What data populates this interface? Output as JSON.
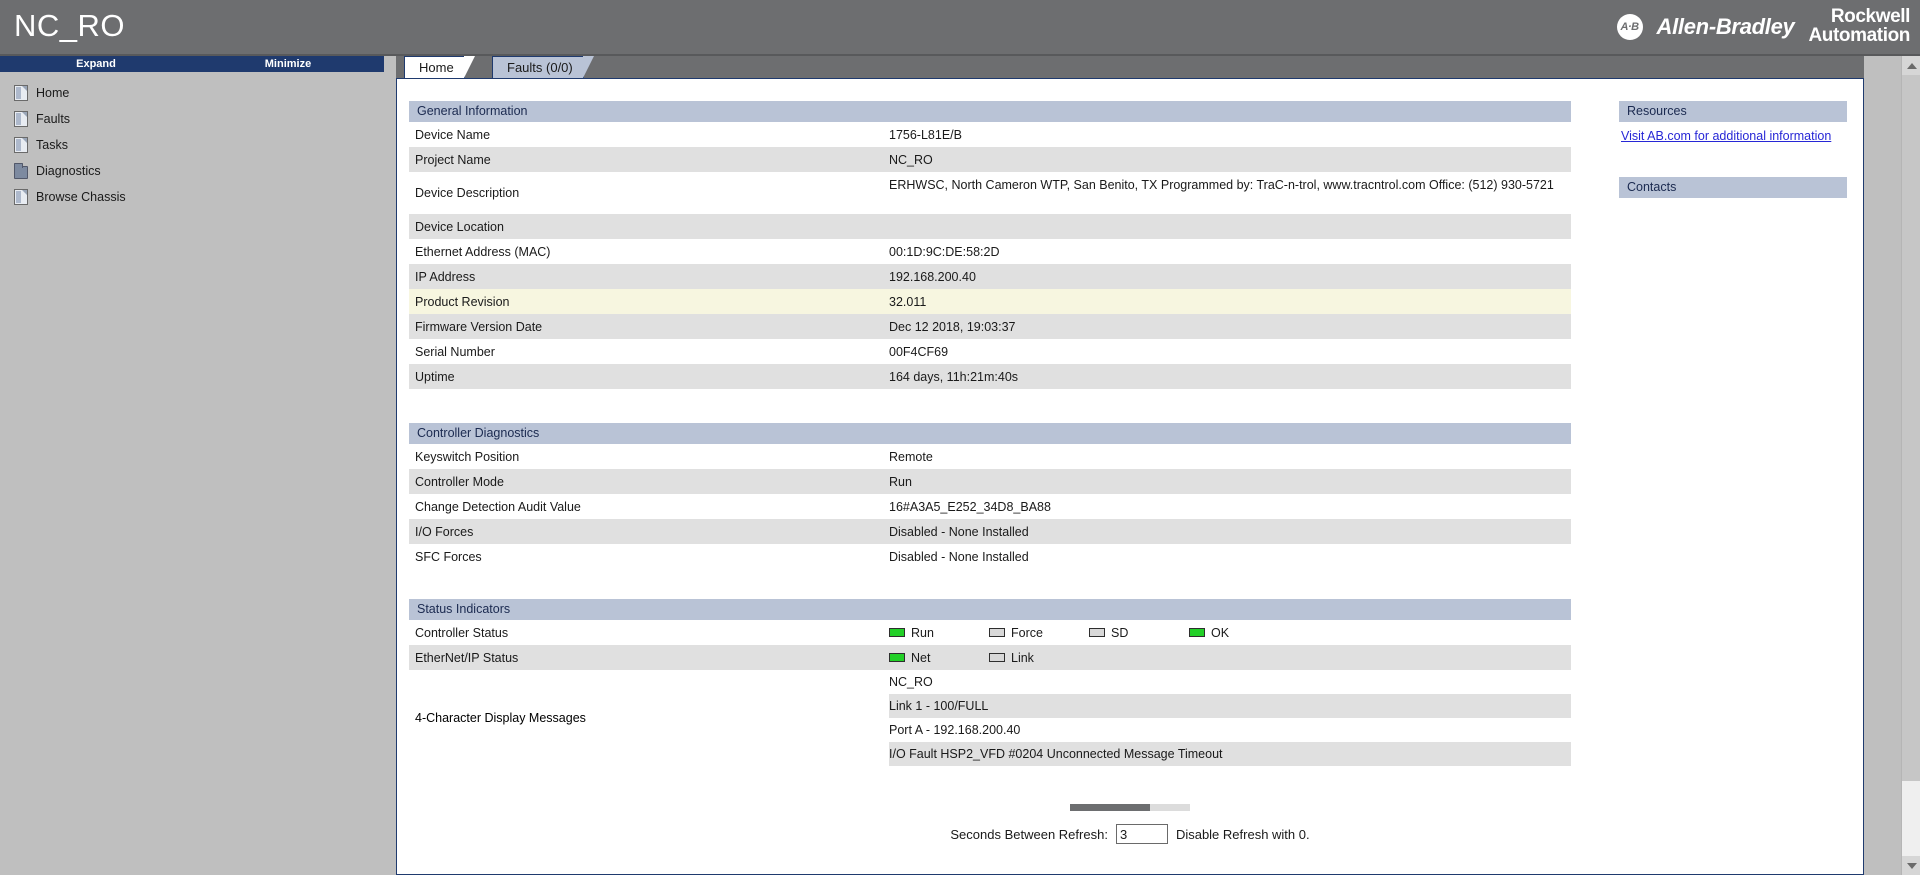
{
  "banner": {
    "app_title": "NC_RO",
    "ab_badge": "A·B",
    "ab_name": "Allen-Bradley",
    "ra_line1": "Rockwell",
    "ra_line2": "Automation",
    "background_color": "#6d6e70"
  },
  "sidebar": {
    "expand_label": "Expand",
    "minimize_label": "Minimize",
    "items": [
      {
        "label": "Home",
        "icon": "document-icon"
      },
      {
        "label": "Faults",
        "icon": "document-icon"
      },
      {
        "label": "Tasks",
        "icon": "document-icon"
      },
      {
        "label": "Diagnostics",
        "icon": "folder-icon"
      },
      {
        "label": "Browse Chassis",
        "icon": "document-icon"
      }
    ]
  },
  "tabs": [
    {
      "label": "Home",
      "active": true
    },
    {
      "label": "Faults (0/0)",
      "active": false
    }
  ],
  "general_information": {
    "heading": "General Information",
    "rows": [
      {
        "key": "Device Name",
        "value": "1756-L81E/B"
      },
      {
        "key": "Project Name",
        "value": "NC_RO"
      },
      {
        "key": "Device Description",
        "value": "ERHWSC, North Cameron WTP, San Benito, TX Programmed by: TraC-n-trol, www.tracntrol.com Office: (512) 930-5721"
      },
      {
        "key": "Device Location",
        "value": ""
      },
      {
        "key": "Ethernet Address (MAC)",
        "value": "00:1D:9C:DE:58:2D"
      },
      {
        "key": "IP Address",
        "value": "192.168.200.40"
      },
      {
        "key": "Product Revision",
        "value": "32.011"
      },
      {
        "key": "Firmware Version Date",
        "value": "Dec 12 2018, 19:03:37"
      },
      {
        "key": "Serial Number",
        "value": "00F4CF69"
      },
      {
        "key": "Uptime",
        "value": "164 days, 11h:21m:40s"
      }
    ]
  },
  "controller_diagnostics": {
    "heading": "Controller Diagnostics",
    "rows": [
      {
        "key": "Keyswitch Position",
        "value": "Remote"
      },
      {
        "key": "Controller Mode",
        "value": "Run"
      },
      {
        "key": "Change Detection Audit Value",
        "value": "16#A3A5_E252_34D8_BA88"
      },
      {
        "key": "I/O Forces",
        "value": "Disabled - None Installed"
      },
      {
        "key": "SFC Forces",
        "value": "Disabled - None Installed"
      }
    ]
  },
  "status_indicators": {
    "heading": "Status Indicators",
    "controller_status": {
      "key": "Controller Status",
      "leds": [
        {
          "label": "Run",
          "state": "on"
        },
        {
          "label": "Force",
          "state": "off"
        },
        {
          "label": "SD",
          "state": "off"
        },
        {
          "label": "OK",
          "state": "on"
        }
      ]
    },
    "ethernet_status": {
      "key": "EtherNet/IP Status",
      "leds": [
        {
          "label": "Net",
          "state": "on"
        },
        {
          "label": "Link",
          "state": "off"
        }
      ]
    },
    "display_messages": {
      "key": "4-Character Display Messages",
      "messages": [
        "NC_RO",
        "Link 1 - 100/FULL",
        "Port A - 192.168.200.40",
        "I/O Fault HSP2_VFD #0204 Unconnected Message Timeout"
      ]
    }
  },
  "rail": {
    "resources_heading": "Resources",
    "resources_link": "Visit AB.com for additional information",
    "contacts_heading": "Contacts"
  },
  "refresh": {
    "label": "Seconds Between Refresh:",
    "value": "3",
    "hint": "Disable Refresh with 0."
  },
  "colors": {
    "banner": "#6d6e70",
    "nav_header": "#1f3a6e",
    "section_header": "#b9c3d6",
    "row_alt": "#e0e0e0",
    "row_highlight": "#f7f6e0",
    "led_on": "#22d027",
    "led_off": "#d8d8d8",
    "link": "#2727d6"
  }
}
